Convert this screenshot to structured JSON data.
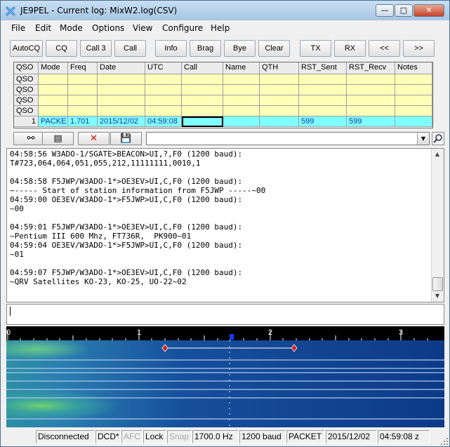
{
  "window": {
    "title": "JE9PEL - Current log: MixW2.log(CSV)"
  },
  "menu": [
    "File",
    "Edit",
    "Mode",
    "Options",
    "View",
    "Configure",
    "Help"
  ],
  "toolbar": [
    "AutoCQ",
    "CQ",
    "Call 3",
    "Call",
    "Info",
    "Brag",
    "Bye",
    "Clear",
    "TX",
    "RX",
    "<<",
    ">>"
  ],
  "grid": {
    "headers": [
      "QSO",
      "Mode",
      "Freq",
      "Date",
      "UTC",
      "Call",
      "Name",
      "QTH",
      "RST_Sent",
      "RST_Recv",
      "Notes"
    ],
    "empty_rows": [
      "QSO",
      "QSO",
      "QSO",
      "QSO"
    ],
    "active_row": [
      "1",
      "PACKE",
      "1.701",
      "2015/12/02",
      "04:59:08",
      "",
      "",
      "",
      "599",
      "599",
      ""
    ]
  },
  "log_text": "04:58:56 W3ADO-1/SGATE>BEACON>UI,?,F0 (1200 baud):\nT#723,064,064,051,055,212,11111111,0010,1\n\n04:58:58 F5JWP/W3ADO-1*>OE3EV>UI,C,F0 (1200 baud):\n~----- Start of station information from F5JWP -----~00\n04:59:00 OE3EV/W3ADO-1*>F5JWP>UI,C,F0 (1200 baud):\n~00\n\n04:59:01 F5JWP/W3ADO-1*>OE3EV>UI,C,F0 (1200 baud):\n~Pentium III 600 Mhz, FT736R,  PK900~01\n04:59:04 OE3EV/W3ADO-1*>F5JWP>UI,C,F0 (1200 baud):\n~01\n\n04:59:07 F5JWP/W3ADO-1*>OE3EV>UI,C,F0 (1200 baud):\n~QRV Satellites KO-23, KO-25, UO-22~02",
  "scale_labels": [
    "0",
    "1",
    "2",
    "3"
  ],
  "status": [
    "Disconnected",
    "DCD*",
    "AFC",
    "Lock",
    "Snap",
    "1700.0 Hz",
    "1200 baud",
    "PACKET",
    "2015/12/02",
    "04:59:08 z"
  ],
  "colors": {
    "grid_row": "#ffffb8",
    "grid_active": "#7fffff",
    "waterfall_bg": "#103f8a",
    "title_bar": "#b8d3ee"
  }
}
